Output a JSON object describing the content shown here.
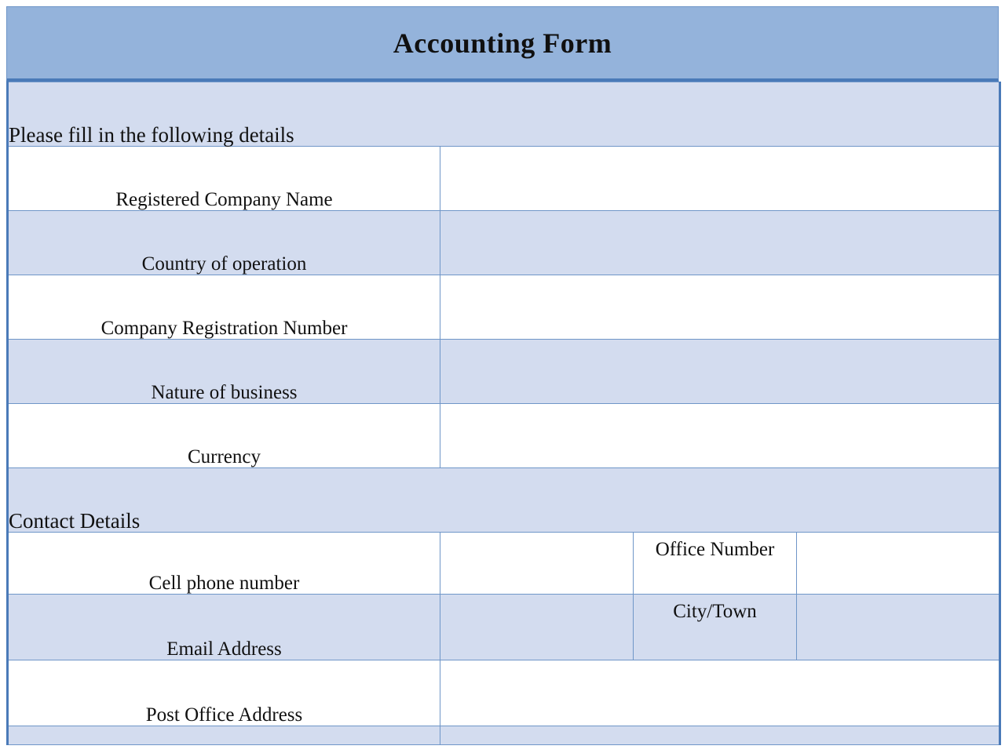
{
  "document": {
    "title": "Accounting Form"
  },
  "sections": [
    {
      "heading": "Please fill in the following details",
      "rows": [
        {
          "label": "Registered Company Name",
          "value": "",
          "shade": "white"
        },
        {
          "label": "Country of operation",
          "value": "",
          "shade": "shade"
        },
        {
          "label": "Company Registration Number",
          "value": "",
          "shade": "white"
        },
        {
          "label": "Nature of business",
          "value": "",
          "shade": "shade"
        },
        {
          "label": "Currency",
          "value": "",
          "shade": "white"
        }
      ]
    },
    {
      "heading": "Contact Details",
      "rows": [
        {
          "label": "Cell phone number",
          "value": "",
          "label2": "Office Number",
          "value2": "",
          "shade": "white"
        },
        {
          "label": "Email Address",
          "value": "",
          "label2": "City/Town",
          "value2": "",
          "shade": "shade"
        },
        {
          "label": "Post Office Address",
          "value": "",
          "shade": "white"
        },
        {
          "label": "",
          "value": "",
          "shade": "shade"
        }
      ]
    }
  ],
  "colors": {
    "title_banner": "#94b3db",
    "row_shade": "#d3dcef",
    "row_white": "#ffffff",
    "border": "#4a7ab8",
    "border_light": "#6f96c8",
    "text": "#111111"
  }
}
